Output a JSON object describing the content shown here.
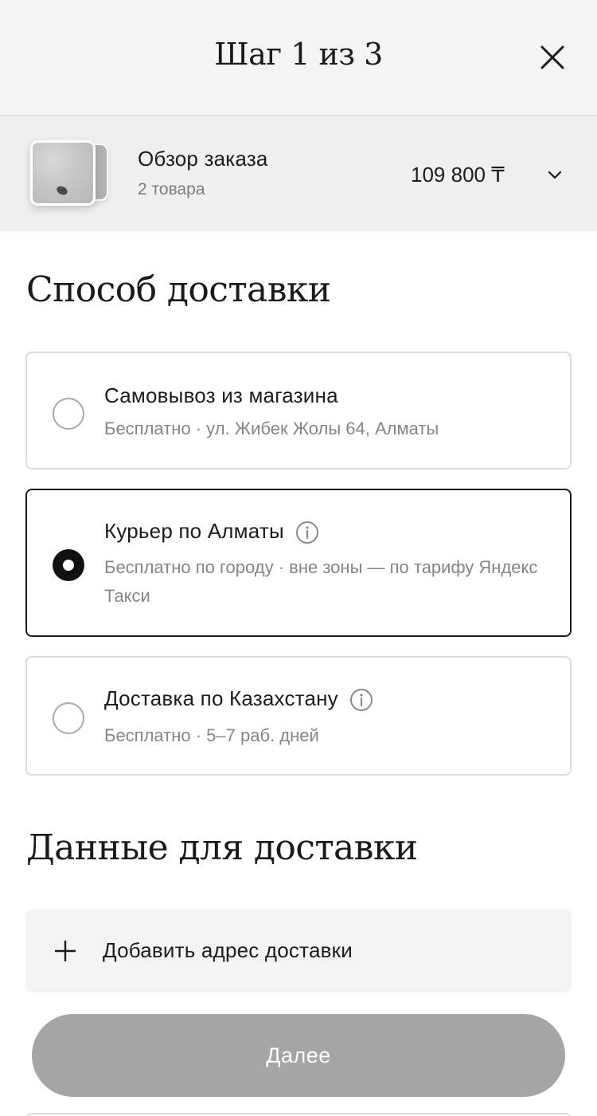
{
  "header": {
    "step_title": "Шаг 1 из 3",
    "close_icon": "close-icon"
  },
  "order_summary": {
    "title": "Обзор заказа",
    "item_count": "2 товара",
    "total": "109 800 ₸",
    "expand_icon": "chevron-down-icon"
  },
  "delivery_method": {
    "heading": "Способ доставки",
    "selected_index": 1,
    "options": [
      {
        "title": "Самовывоз из магазина",
        "subtitle": "Бесплатно · ул. Жибек Жолы 64, Алматы",
        "has_info": false
      },
      {
        "title": "Курьер по Алматы",
        "subtitle": "Бесплатно по городу · вне зоны — по тарифу Яндекс Такси",
        "has_info": true
      },
      {
        "title": "Доставка по Казахстану",
        "subtitle": "Бесплатно · 5–7 раб. дней",
        "has_info": true
      }
    ]
  },
  "delivery_details": {
    "heading": "Данные для доставки",
    "add_address_label": "Добавить адрес доставки"
  },
  "next_button": {
    "label": "Далее",
    "enabled": false
  },
  "colors": {
    "header_bg": "#f4f4f4",
    "summary_bg": "#efefef",
    "selected_border": "#1a1a1a",
    "disabled_button": "#a5a5a5"
  }
}
